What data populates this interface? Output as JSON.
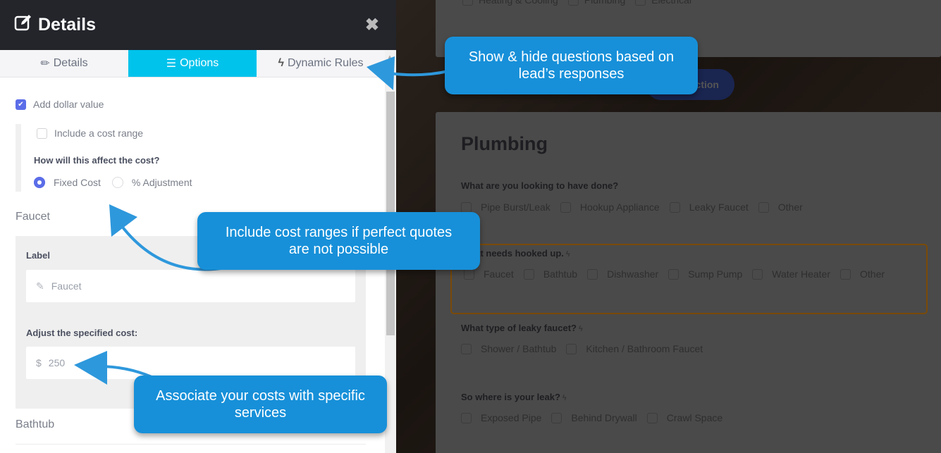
{
  "panel": {
    "title": "Details",
    "tabs": [
      {
        "label": "Details",
        "icon": "pencil-icon",
        "active": false
      },
      {
        "label": "Options",
        "icon": "list-icon",
        "active": true
      },
      {
        "label": "Dynamic Rules",
        "icon": "bolt-icon",
        "active": false
      }
    ],
    "add_dollar_value": {
      "label": "Add dollar value",
      "checked": true
    },
    "include_cost_range": {
      "label": "Include a cost range",
      "checked": false
    },
    "cost_question": "How will this affect the cost?",
    "cost_type": {
      "options": [
        "Fixed Cost",
        "% Adjustment"
      ],
      "selected": "Fixed Cost"
    },
    "items": [
      {
        "name": "Faucet",
        "label_field_label": "Label",
        "label_value": "Faucet",
        "cost_field_label": "Adjust the specified cost:",
        "currency_symbol": "$",
        "cost_value": "250"
      },
      {
        "name": "Bathtub"
      }
    ]
  },
  "form_preview": {
    "top_options": [
      "Heating & Cooling",
      "Plumbing",
      "Electrical"
    ],
    "hidden_button_label": "ction",
    "section_title": "Plumbing",
    "questions": [
      {
        "text": "What are you looking to have done?",
        "dynamic": false,
        "options": [
          "Pipe Burst/Leak",
          "Hookup Appliance",
          "Leaky Faucet",
          "Other"
        ]
      },
      {
        "text": "What needs hooked up.",
        "dynamic": true,
        "options": [
          "Faucet",
          "Bathtub",
          "Dishwasher",
          "Sump Pump",
          "Water Heater",
          "Other"
        ]
      },
      {
        "text": "What type of leaky faucet?",
        "dynamic": true,
        "options": [
          "Shower / Bathtub",
          "Kitchen / Bathroom Faucet"
        ]
      },
      {
        "text": "So where is your leak?",
        "dynamic": true,
        "options": [
          "Exposed Pipe",
          "Behind Drywall",
          "Crawl Space"
        ]
      }
    ]
  },
  "callouts": {
    "dynamic_rules": "Show & hide questions based on  lead’s responses",
    "cost_ranges": "Include cost ranges if perfect quotes are not possible",
    "associate_costs": "Associate your costs with specific services"
  },
  "colors": {
    "accent_tab": "#00c3ec",
    "callout": "#1790d9",
    "checkbox": "#5b6de8",
    "header": "#23252b",
    "highlight_border": "#7a4a08"
  }
}
